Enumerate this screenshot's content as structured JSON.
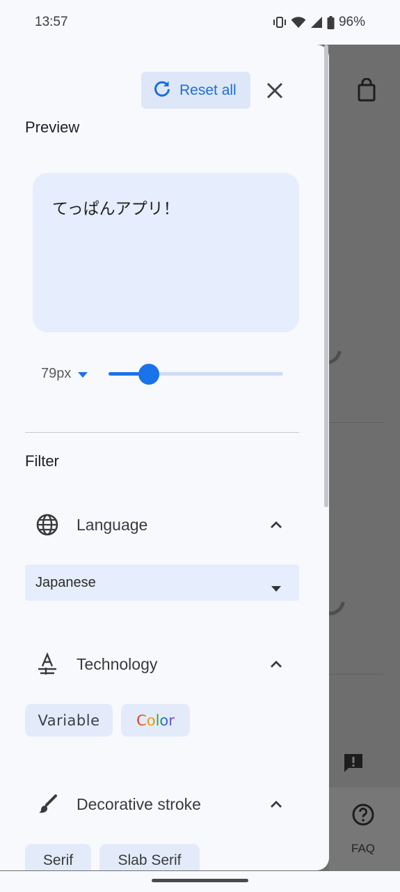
{
  "status_bar": {
    "time": "13:57",
    "battery": "96%"
  },
  "background_page": {
    "faq_label": "FAQ"
  },
  "panel": {
    "reset_label": "Reset all",
    "preview_title": "Preview",
    "preview_text": "てっぱんアプリ！",
    "size": {
      "label": "79px",
      "slider_fraction": 0.23
    },
    "filter_title": "Filter",
    "language": {
      "label": "Language",
      "selected": "Japanese"
    },
    "technology": {
      "label": "Technology",
      "chips": [
        "Variable",
        "Color"
      ]
    },
    "decorative_stroke": {
      "label": "Decorative stroke",
      "chips": [
        "Serif",
        "Slab Serif"
      ]
    }
  },
  "colors": {
    "accent": "#1a73e8",
    "chip_bg": "#e3ebfb",
    "panel_bg": "#f8f9fd",
    "scrim": "#6e6e6e"
  },
  "icons": {
    "reset": "refresh-icon",
    "close": "close-icon",
    "language": "globe-icon",
    "technology": "font-technology-icon",
    "decorative": "brush-icon",
    "expand": "chevron-up-icon",
    "dropdown": "caret-down-icon"
  }
}
